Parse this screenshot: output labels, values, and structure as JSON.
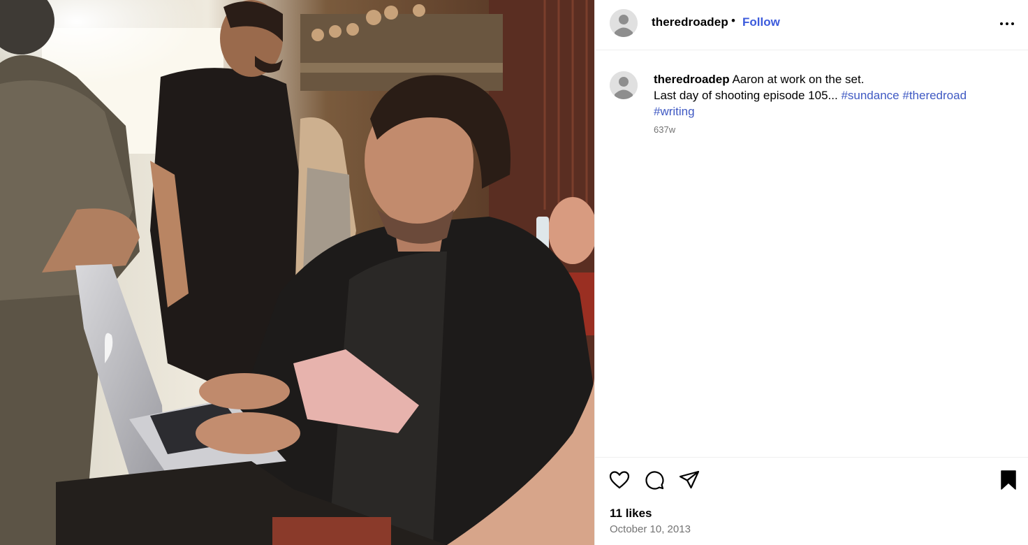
{
  "post": {
    "username": "theredroadep",
    "separator": "•",
    "follow_label": "Follow",
    "caption": {
      "username": "theredroadep",
      "line1": "Aaron at work on the set.",
      "line2": "Last day of shooting episode 105...",
      "hashtags": [
        "#sundance",
        "#theredroad",
        "#writing"
      ]
    },
    "time_ago": "637w",
    "likes_text": "11 likes",
    "date": "October 10, 2013"
  },
  "icons": {
    "more": "more-options-icon",
    "like": "heart-icon",
    "comment": "comment-icon",
    "share": "share-icon",
    "save": "bookmark-icon"
  },
  "colors": {
    "link": "#3c5bdc",
    "hashtag": "#3f59c3",
    "muted": "#737373",
    "border": "#efefef"
  }
}
